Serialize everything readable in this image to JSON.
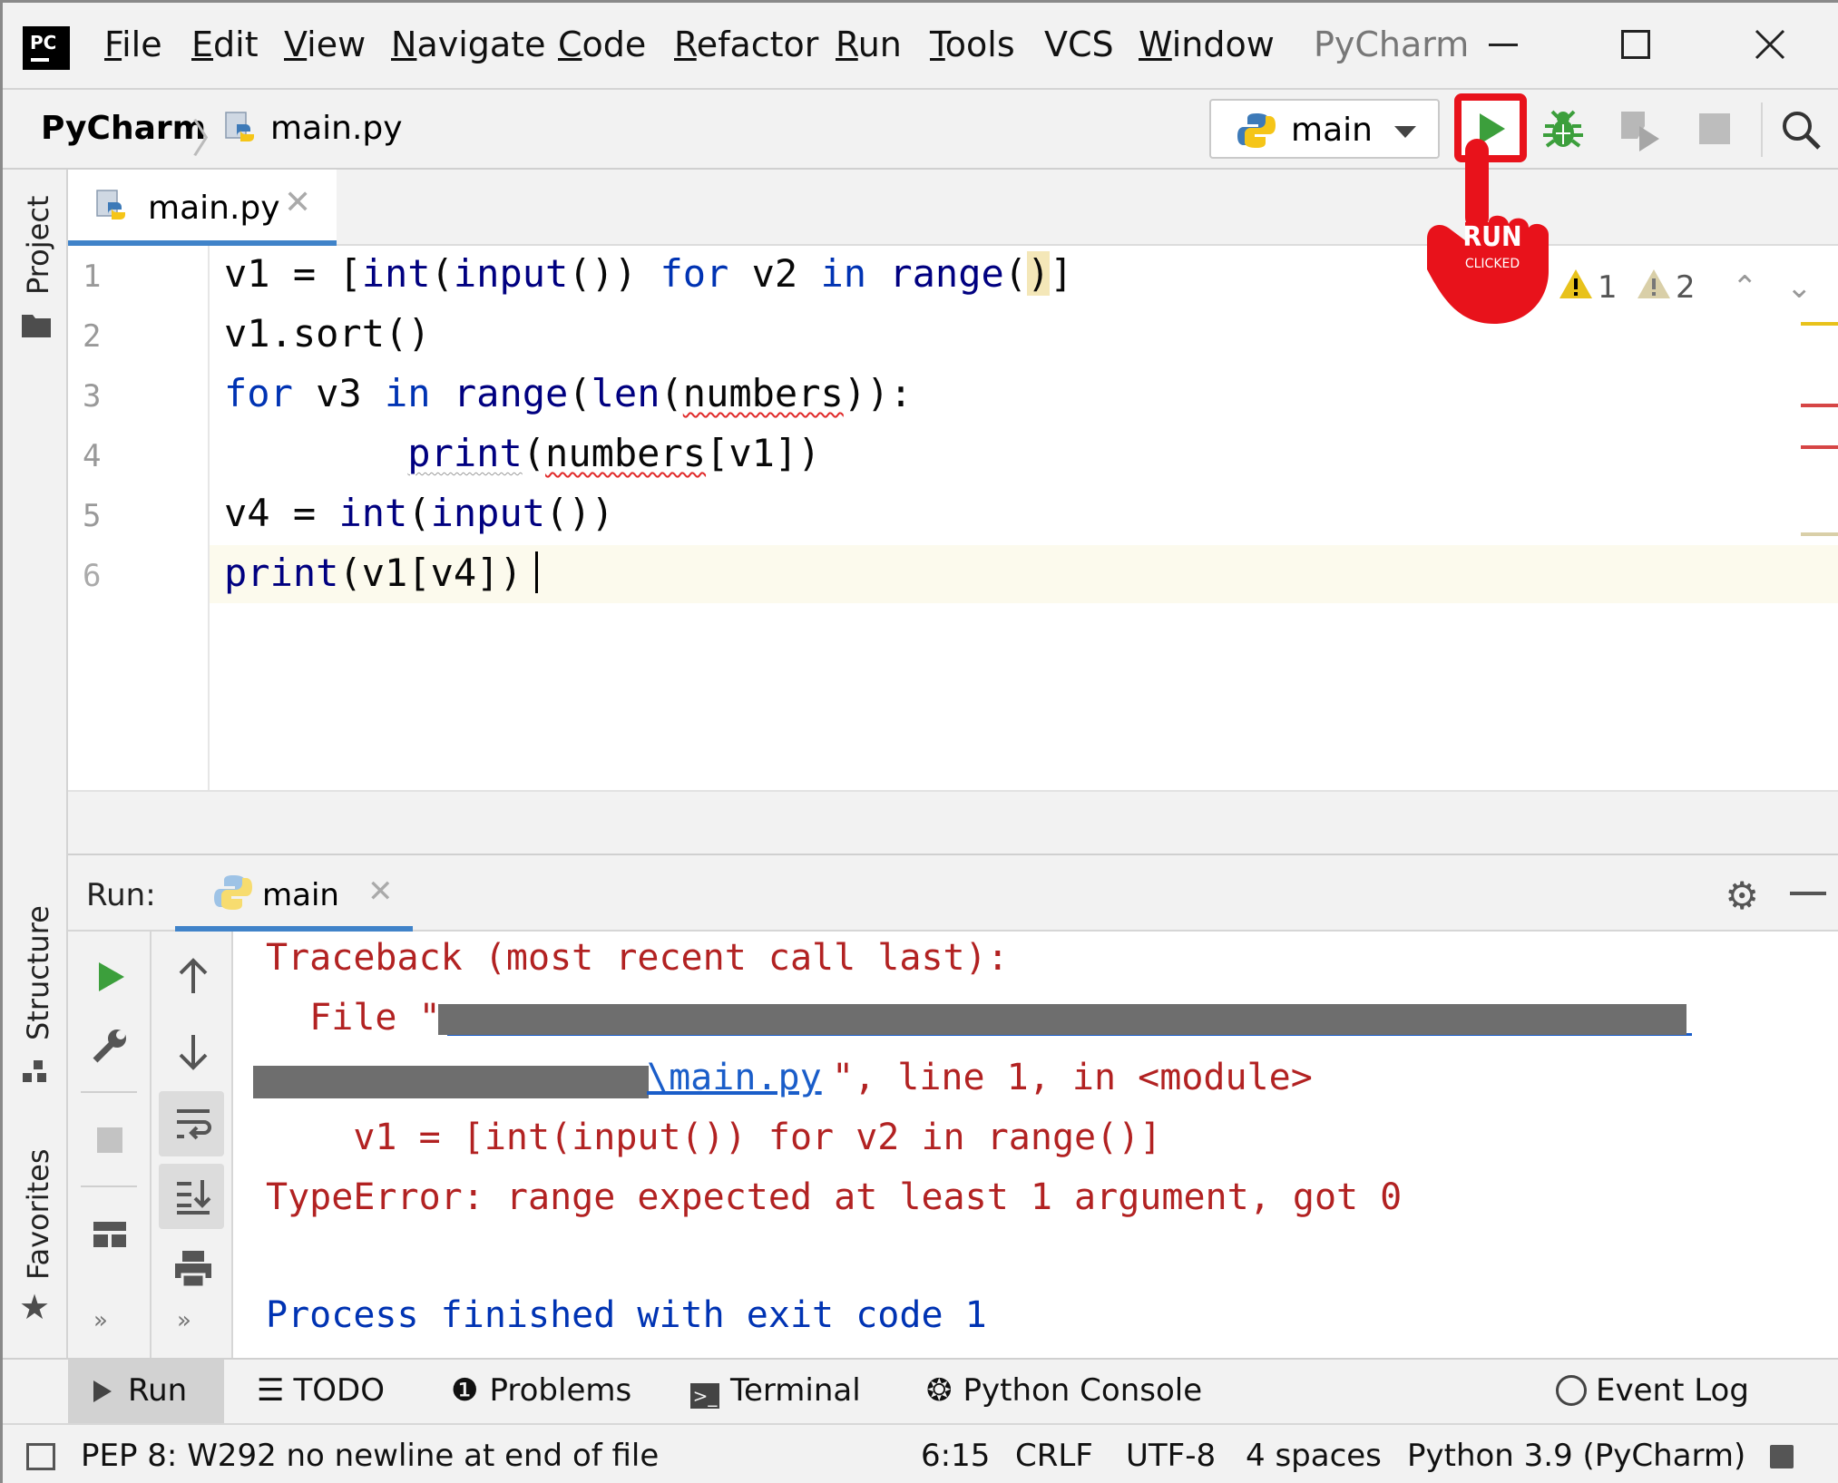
{
  "menubar": {
    "items": [
      "File",
      "Edit",
      "View",
      "Navigate",
      "Code",
      "Refactor",
      "Run",
      "Tools",
      "VCS",
      "Window"
    ],
    "window_title": "PyCharm",
    "logo_text": "PC"
  },
  "breadcrumb": {
    "project": "PyCharm",
    "file": "main.py"
  },
  "run_config": {
    "selected": "main"
  },
  "annotation": {
    "line1": "RUN",
    "line2": "CLICKED"
  },
  "side_panels": {
    "project": "Project",
    "structure": "Structure",
    "favorites": "Favorites"
  },
  "editor": {
    "tab_label": "main.py",
    "inspections": {
      "errors": "2",
      "warnings": "1",
      "weak_warnings": "2"
    },
    "lines": [
      {
        "num": "1"
      },
      {
        "num": "2"
      },
      {
        "num": "3"
      },
      {
        "num": "4"
      },
      {
        "num": "5"
      },
      {
        "num": "6"
      }
    ]
  },
  "run_panel": {
    "label": "Run:",
    "tab_label": "main",
    "console": {
      "traceback": "Traceback (most recent call last):",
      "file_prefix": "  File \"",
      "file_link_tail": "\\main.py",
      "file_suffix": "\", line 1, in <module>",
      "code_line": "    v1 = [int(input()) for v2 in range()]",
      "error": "TypeError: range expected at least 1 argument, got 0",
      "exit": "Process finished with exit code 1"
    }
  },
  "bottom_tools": {
    "run": "Run",
    "todo": "TODO",
    "problems": "Problems",
    "terminal": "Terminal",
    "python_console": "Python Console",
    "event_log": "Event Log"
  },
  "statusbar": {
    "message": "PEP 8: W292 no newline at end of file",
    "position": "6:15",
    "line_separator": "CRLF",
    "encoding": "UTF-8",
    "indent": "4 spaces",
    "interpreter": "Python 3.9 (PyCharm)"
  },
  "colors": {
    "keyword": "#0033b3",
    "error_text": "#b22222",
    "run_green": "#3c9f3c",
    "highlight_red": "#e8121b",
    "tab_underline": "#4083c9"
  }
}
